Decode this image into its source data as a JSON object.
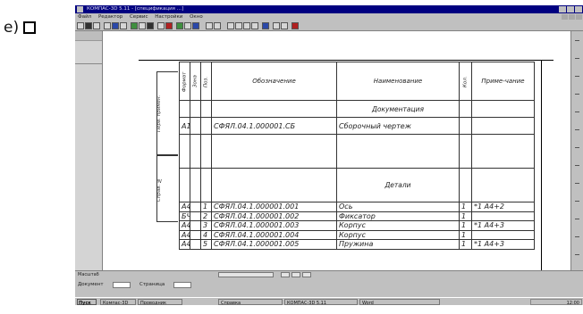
{
  "outer_label": "e)",
  "window": {
    "title": "КОМПАС-3D 5.11 - [спецификация ...]",
    "menu": [
      "Файл",
      "Редактор",
      "Сервис",
      "Настройки",
      "Окно"
    ]
  },
  "spec": {
    "headers": {
      "format": "Формат",
      "zone": "Зона",
      "pos": "Поз.",
      "designation": "Обозначение",
      "name": "Наименование",
      "qty": "Кол.",
      "note": "Приме-чание"
    },
    "section_documentation": "Документация",
    "doc_row": {
      "format": "А1",
      "designation": "СФЯЛ.04.1.000001.СБ",
      "name": "Сборочный чертеж"
    },
    "section_details": "Детали",
    "rows": [
      {
        "format": "А4",
        "pos": "1",
        "designation": "СФЯЛ.04.1.000001.001",
        "name": "Ось",
        "qty": "1",
        "note": "*1 А4+2"
      },
      {
        "format": "БЧ",
        "pos": "2",
        "designation": "СФЯЛ.04.1.000001.002",
        "name": "Фиксатор",
        "qty": "1",
        "note": ""
      },
      {
        "format": "А4",
        "pos": "3",
        "designation": "СФЯЛ.04.1.000001.003",
        "name": "Корпус",
        "qty": "1",
        "note": "*1 А4+3"
      },
      {
        "format": "А4",
        "pos": "4",
        "designation": "СФЯЛ.04.1.000001.004",
        "name": "Корпус",
        "qty": "1",
        "note": ""
      },
      {
        "format": "А4",
        "pos": "5",
        "designation": "СФЯЛ.04.1.000001.005",
        "name": "Пружина",
        "qty": "1",
        "note": "*1 А4+3"
      }
    ],
    "stamp_top": "Перв. примен.",
    "stamp_bottom": "Справ. №"
  },
  "statusbar": {
    "left": "Масштаб"
  },
  "bottom_panel": {
    "label1": "Документ",
    "label2": "Страница"
  },
  "taskbar": {
    "start": "Пуск",
    "tasks": [
      "Компас-3D",
      "Проводник",
      "Справка",
      "КОМПАС-3D 5.11",
      "Word"
    ],
    "clock": "12:00"
  }
}
